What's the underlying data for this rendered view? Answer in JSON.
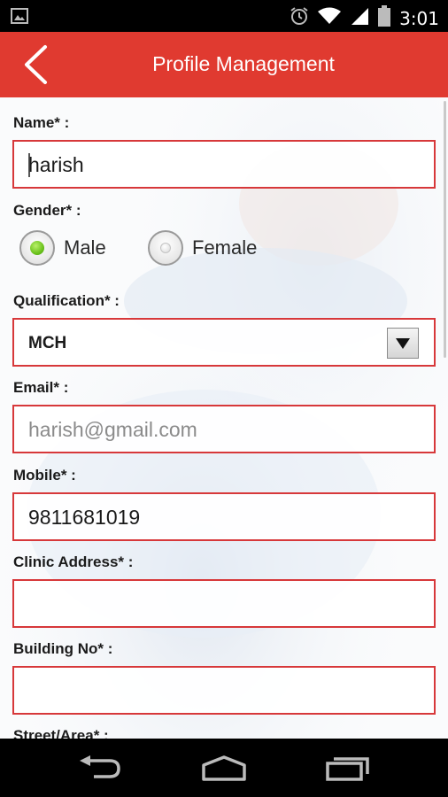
{
  "status_bar": {
    "time": "3:01",
    "icons": [
      "image-notification-icon",
      "alarm-icon",
      "wifi-icon",
      "signal-icon",
      "battery-icon"
    ]
  },
  "app_bar": {
    "title": "Profile Management",
    "back_icon": "chevron-left-icon",
    "color": "#e03a30"
  },
  "form": {
    "name": {
      "label": "Name* :",
      "value": "harish"
    },
    "gender": {
      "label": "Gender* :",
      "options": [
        "Male",
        "Female"
      ],
      "selected": "Male"
    },
    "qualification": {
      "label": "Qualification* :",
      "value": "MCH"
    },
    "email": {
      "label": "Email* :",
      "placeholder": "harish@gmail.com"
    },
    "mobile": {
      "label": "Mobile* :",
      "value": "9811681019"
    },
    "clinic_address": {
      "label": "Clinic Address* :",
      "value": ""
    },
    "building_no": {
      "label": "Building No* :",
      "value": ""
    },
    "street_area": {
      "label": "Street/Area* :"
    }
  },
  "colors": {
    "accent": "#e03a30",
    "field_border": "#d7383a",
    "radio_selected": "#6cc21c"
  },
  "nav_bar": {
    "icons": [
      "back-icon",
      "home-icon",
      "recent-apps-icon"
    ]
  }
}
